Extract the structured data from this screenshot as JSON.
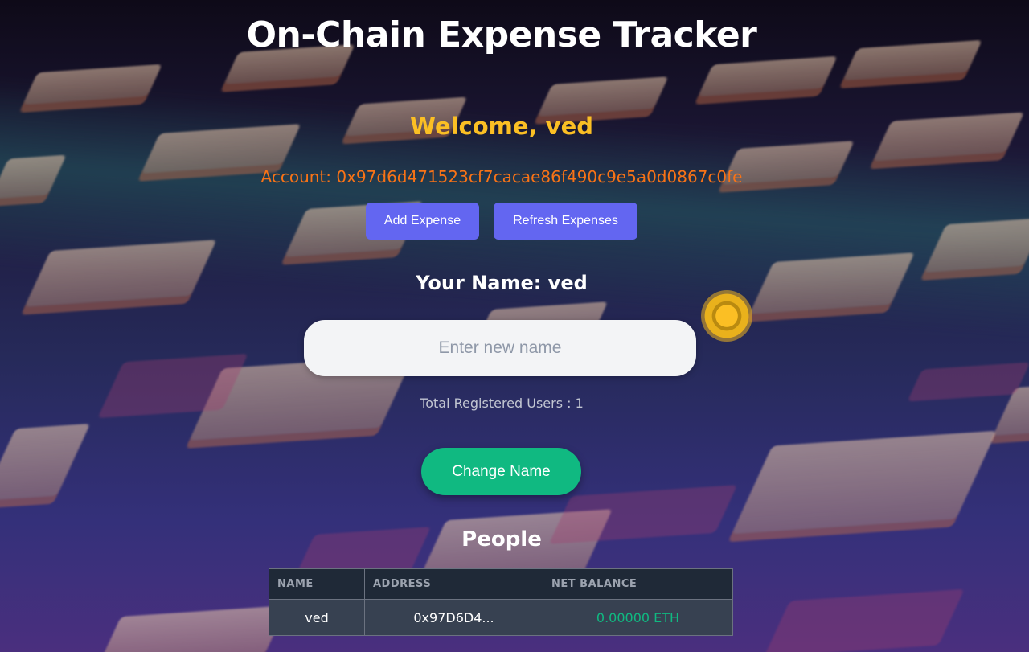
{
  "app": {
    "title": "On-Chain Expense Tracker"
  },
  "welcome": {
    "text": "Welcome, ved"
  },
  "account": {
    "text": "Account: 0x97d6d471523cf7cacae86f490c9e5a0d0867c0fe"
  },
  "actions": {
    "add_expense_label": "Add Expense",
    "refresh_label": "Refresh Expenses"
  },
  "profile": {
    "your_name_text": "Your Name: ved",
    "name_input_placeholder": "Enter new name",
    "name_input_value": "",
    "total_users_text": "Total Registered Users : 1",
    "change_name_label": "Change Name"
  },
  "people": {
    "title": "People",
    "columns": [
      "NAME",
      "ADDRESS",
      "NET BALANCE"
    ],
    "rows": [
      {
        "name": "ved",
        "address": "0x97D6D4...",
        "balance": "0.00000 ETH"
      }
    ]
  },
  "colors": {
    "accent_indigo": "#6366f1",
    "accent_green": "#10b981",
    "welcome_yellow": "#fbbf24",
    "account_orange": "#f97316"
  },
  "icons": {
    "cursor_indicator": "coin-icon"
  }
}
